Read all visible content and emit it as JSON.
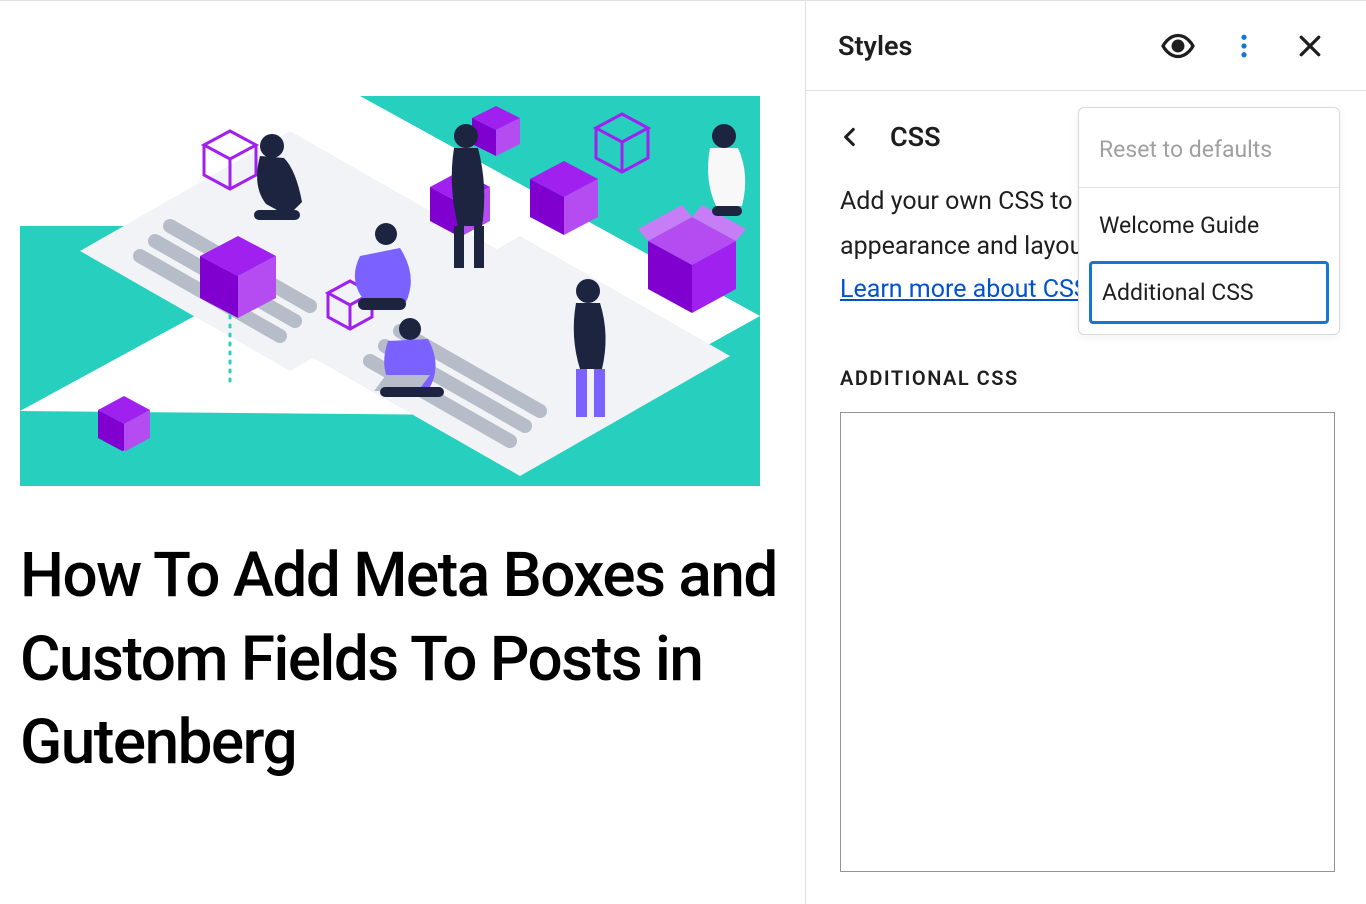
{
  "main": {
    "post_title": "How To Add Meta Boxes and Custom Fields To Posts in Gutenberg"
  },
  "sidebar": {
    "panel_title": "Styles",
    "subnav_title": "CSS",
    "description": "Add your own CSS to customize the appearance and layout of your site.",
    "learn_more": "Learn more about CSS",
    "section_label": "ADDITIONAL CSS",
    "css_value": ""
  },
  "menu": {
    "items": [
      {
        "label": "Reset to defaults",
        "disabled": true
      },
      {
        "label": "Welcome Guide",
        "disabled": false
      },
      {
        "label": "Additional CSS",
        "disabled": false,
        "selected": true
      }
    ]
  },
  "icons": {
    "eye": "style-book-icon",
    "kebab": "more-options-icon",
    "close": "close-icon",
    "back": "back-icon"
  }
}
